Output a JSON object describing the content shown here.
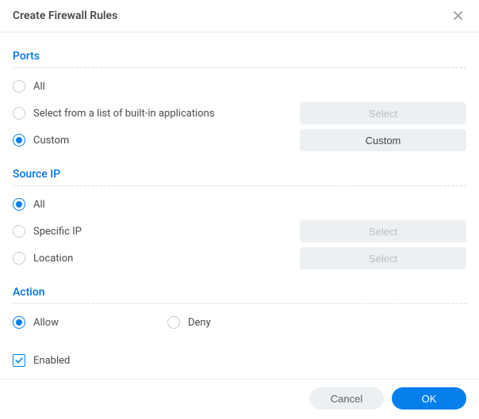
{
  "dialog": {
    "title": "Create Firewall Rules"
  },
  "ports": {
    "heading": "Ports",
    "all": "All",
    "select_apps": "Select from a list of built-in applications",
    "select_apps_btn": "Select",
    "custom": "Custom",
    "custom_btn": "Custom",
    "selected": "custom"
  },
  "source_ip": {
    "heading": "Source IP",
    "all": "All",
    "specific": "Specific IP",
    "specific_btn": "Select",
    "location": "Location",
    "location_btn": "Select",
    "selected": "all"
  },
  "action": {
    "heading": "Action",
    "allow": "Allow",
    "deny": "Deny",
    "selected": "allow"
  },
  "enabled": {
    "label": "Enabled",
    "checked": true
  },
  "footer": {
    "cancel": "Cancel",
    "ok": "OK"
  }
}
